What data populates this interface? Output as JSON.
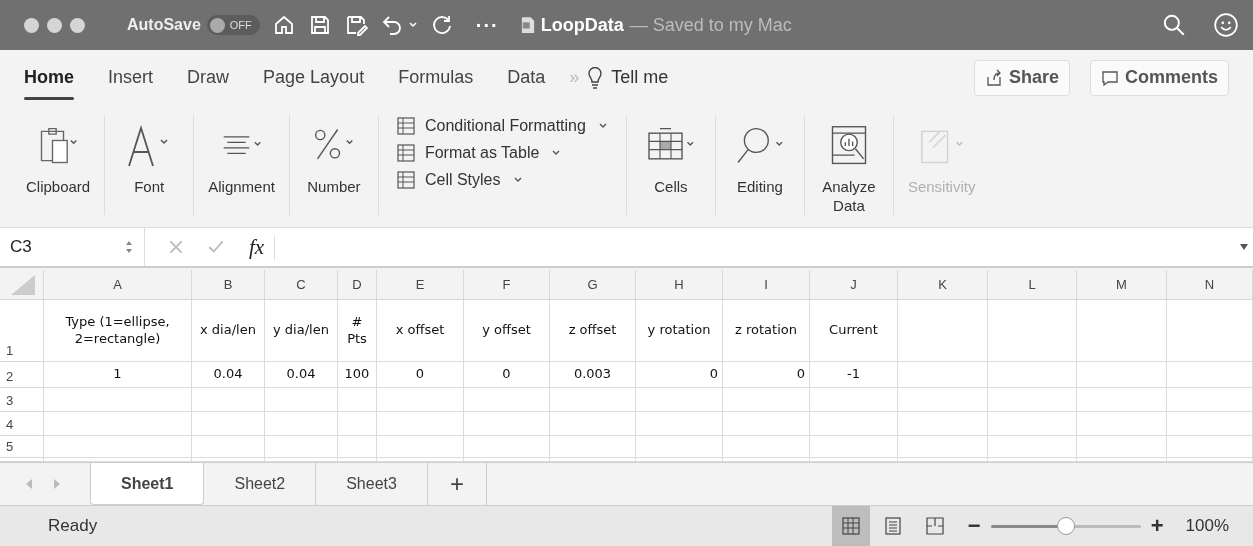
{
  "title_bar": {
    "autosave_label": "AutoSave",
    "autosave": {
      "on": false,
      "label": "OFF"
    },
    "more": "···",
    "document": "LoopData",
    "status": "— Saved to my Mac"
  },
  "ribbon_tabs": [
    {
      "label": "Home",
      "selected": true
    },
    {
      "label": "Insert",
      "selected": false
    },
    {
      "label": "Draw",
      "selected": false
    },
    {
      "label": "Page Layout",
      "selected": false
    },
    {
      "label": "Formulas",
      "selected": false
    },
    {
      "label": "Data",
      "selected": false
    }
  ],
  "overflow": "»",
  "tell_me": "Tell me",
  "share": "Share",
  "comments": "Comments",
  "ribbon_groups": [
    {
      "kind": "clipboard",
      "label": "Clipboard",
      "disabled": false
    },
    {
      "kind": "font",
      "label": "Font",
      "disabled": false
    },
    {
      "kind": "alignment",
      "label": "Alignment",
      "disabled": false
    },
    {
      "kind": "number",
      "label": "Number",
      "disabled": false
    }
  ],
  "styles": [
    "Conditional Formatting",
    "Format as Table",
    "Cell Styles"
  ],
  "ribbon_groups_right": [
    {
      "kind": "cells",
      "label": "Cells",
      "disabled": false
    },
    {
      "kind": "editing",
      "label": "Editing",
      "disabled": false
    },
    {
      "kind": "analyze",
      "label": "Analyze Data",
      "disabled": false
    },
    {
      "kind": "sensitivity",
      "label": "Sensitivity",
      "disabled": true
    }
  ],
  "name_box": "C3",
  "fx": "fx",
  "columns": [
    "A",
    "B",
    "C",
    "D",
    "E",
    "F",
    "G",
    "H",
    "I",
    "J",
    "K",
    "L",
    "M",
    "N"
  ],
  "rows": [
    {
      "number": "1",
      "cells": [
        {
          "text": "Type (1=ellipse, 2=rectangle)",
          "kind": "centered"
        },
        {
          "text": "x dia/len",
          "kind": "centered"
        },
        {
          "text": "y dia/len",
          "kind": "centered"
        },
        {
          "text": "# Pts",
          "kind": "centered"
        },
        {
          "text": "x offset",
          "kind": "centered"
        },
        {
          "text": "y offset",
          "kind": "centered"
        },
        {
          "text": "z offset",
          "kind": "centered"
        },
        {
          "text": "y rotation",
          "kind": "centered"
        },
        {
          "text": "z rotation",
          "kind": "centered"
        },
        {
          "text": "Current",
          "kind": "centered"
        }
      ]
    },
    {
      "number": "2",
      "cells": [
        {
          "text": "1",
          "kind": "centered"
        },
        {
          "text": "0.04",
          "kind": "centered"
        },
        {
          "text": "0.04",
          "kind": "centered"
        },
        {
          "text": "100",
          "kind": "centered"
        },
        {
          "text": "0",
          "kind": "centered"
        },
        {
          "text": "0",
          "kind": "centered"
        },
        {
          "text": "0.003",
          "kind": "centered"
        },
        {
          "text": "0",
          "kind": "general"
        },
        {
          "text": "0",
          "kind": "general"
        },
        {
          "text": "-1",
          "kind": "centered"
        }
      ]
    },
    {
      "number": "3",
      "cells": []
    },
    {
      "number": "4",
      "cells": []
    },
    {
      "number": "5",
      "cells": []
    }
  ],
  "sheets": [
    {
      "label": "Sheet1",
      "selected": true
    },
    {
      "label": "Sheet2",
      "selected": false
    },
    {
      "label": "Sheet3",
      "selected": false
    }
  ],
  "add_sheet": "+",
  "status": "Ready",
  "views": [
    {
      "kind": "normal",
      "selected": true
    },
    {
      "kind": "page",
      "selected": false
    },
    {
      "kind": "break",
      "selected": false
    }
  ],
  "zoom": {
    "minus": "−",
    "plus": "+",
    "level": 0.5,
    "reading": "100%"
  }
}
